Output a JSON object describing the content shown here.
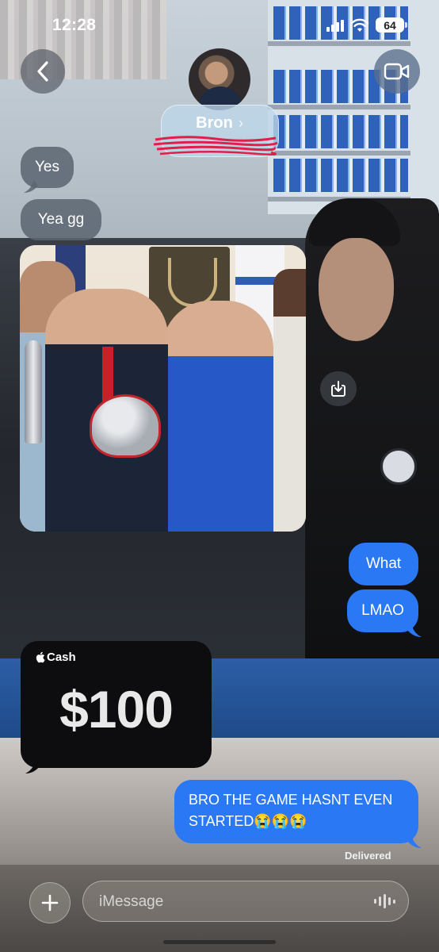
{
  "status_bar": {
    "time": "12:28",
    "battery": "64"
  },
  "header": {
    "contact_name": "Bron"
  },
  "icons": {
    "back": "chevron-left-icon",
    "video": "video-camera-icon",
    "save": "download-icon",
    "plus": "plus-icon",
    "mic": "waveform-icon",
    "cash": "apple-icon"
  },
  "messages": [
    {
      "side": "in",
      "type": "text",
      "text": "Yes"
    },
    {
      "side": "in",
      "type": "text",
      "text": "Yea gg"
    },
    {
      "side": "in",
      "type": "photo"
    },
    {
      "side": "out",
      "type": "text",
      "text": "What"
    },
    {
      "side": "out",
      "type": "text",
      "text": "LMAO"
    },
    {
      "side": "in",
      "type": "cash",
      "brand": "Cash",
      "amount": "$100"
    },
    {
      "side": "out",
      "type": "text",
      "text": "BRO THE GAME HASNT EVEN STARTED😭😭😭"
    }
  ],
  "delivery_status": "Delivered",
  "composer": {
    "placeholder": "iMessage"
  },
  "colors": {
    "outgoing_bubble": "#2a78f4",
    "incoming_bubble": "#5b6571",
    "cash_card": "#0d0d0f"
  }
}
